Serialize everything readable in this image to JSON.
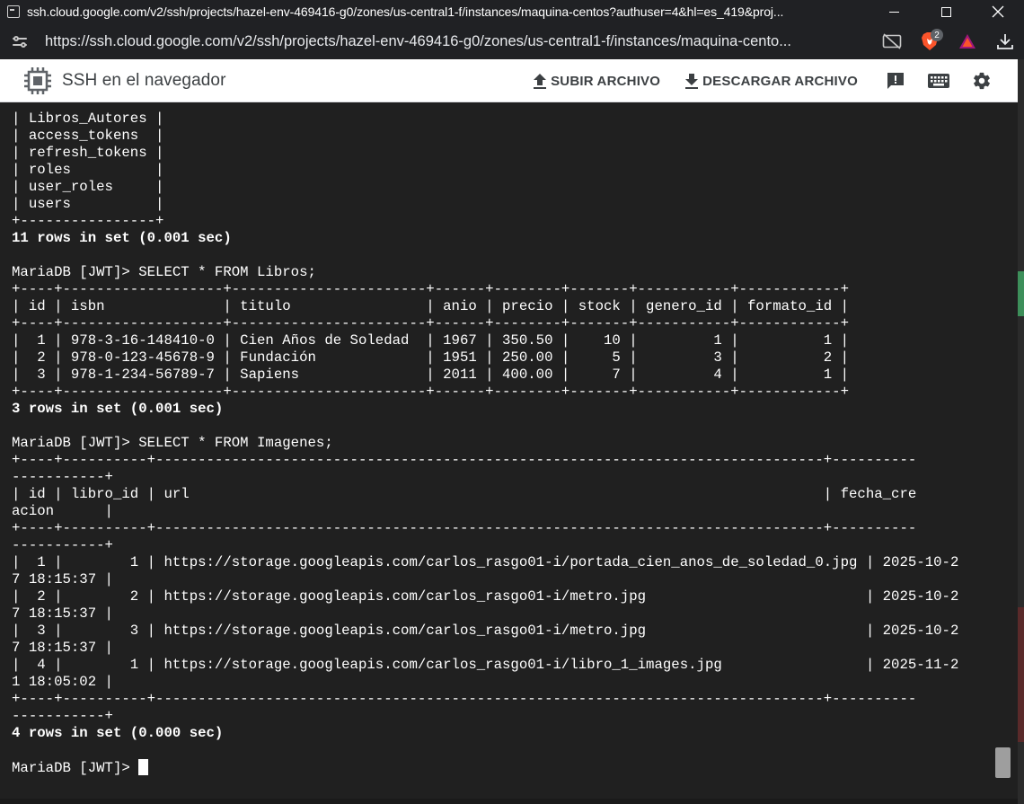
{
  "window": {
    "title": "ssh.cloud.google.com/v2/ssh/projects/hazel-env-469416-g0/zones/us-central1-f/instances/maquina-centos?authuser=4&hl=es_419&proj..."
  },
  "addressbar": {
    "url": "https://ssh.cloud.google.com/v2/ssh/projects/hazel-env-469416-g0/zones/us-central1-f/instances/maquina-cento...",
    "brave_badge_count": "2"
  },
  "app": {
    "title": "SSH en el navegador",
    "upload_label": "SUBIR ARCHIVO",
    "download_label": "DESCARGAR ARCHIVO"
  },
  "terminal": {
    "lines": [
      {
        "text": "| Libros_Autores |",
        "bold": false
      },
      {
        "text": "| access_tokens  |",
        "bold": false
      },
      {
        "text": "| refresh_tokens |",
        "bold": false
      },
      {
        "text": "| roles          |",
        "bold": false
      },
      {
        "text": "| user_roles     |",
        "bold": false
      },
      {
        "text": "| users          |",
        "bold": false
      },
      {
        "text": "+----------------+",
        "bold": false
      },
      {
        "text": "11 rows in set (0.001 sec)",
        "bold": true
      },
      {
        "text": "",
        "bold": false
      },
      {
        "text": "MariaDB [JWT]> SELECT * FROM Libros;",
        "bold": false
      },
      {
        "text": "+----+-------------------+-----------------------+------+--------+-------+-----------+------------+",
        "bold": false
      },
      {
        "text": "| id | isbn              | titulo                | anio | precio | stock | genero_id | formato_id |",
        "bold": false
      },
      {
        "text": "+----+-------------------+-----------------------+------+--------+-------+-----------+------------+",
        "bold": false
      },
      {
        "text": "|  1 | 978-3-16-148410-0 | Cien Años de Soledad  | 1967 | 350.50 |    10 |         1 |          1 |",
        "bold": false
      },
      {
        "text": "|  2 | 978-0-123-45678-9 | Fundación             | 1951 | 250.00 |     5 |         3 |          2 |",
        "bold": false
      },
      {
        "text": "|  3 | 978-1-234-56789-7 | Sapiens               | 2011 | 400.00 |     7 |         4 |          1 |",
        "bold": false
      },
      {
        "text": "+----+-------------------+-----------------------+------+--------+-------+-----------+------------+",
        "bold": false
      },
      {
        "text": "3 rows in set (0.001 sec)",
        "bold": true
      },
      {
        "text": "",
        "bold": false
      },
      {
        "text": "MariaDB [JWT]> SELECT * FROM Imagenes;",
        "bold": false
      },
      {
        "text": "+----+----------+-------------------------------------------------------------------------------+----------",
        "bold": false
      },
      {
        "text": "-----------+",
        "bold": false
      },
      {
        "text": "| id | libro_id | url                                                                           | fecha_cre",
        "bold": false
      },
      {
        "text": "acion      |",
        "bold": false
      },
      {
        "text": "+----+----------+-------------------------------------------------------------------------------+----------",
        "bold": false
      },
      {
        "text": "-----------+",
        "bold": false
      },
      {
        "text": "|  1 |        1 | https://storage.googleapis.com/carlos_rasgo01-i/portada_cien_anos_de_soledad_0.jpg | 2025-10-2",
        "bold": false
      },
      {
        "text": "7 18:15:37 |",
        "bold": false
      },
      {
        "text": "|  2 |        2 | https://storage.googleapis.com/carlos_rasgo01-i/metro.jpg                          | 2025-10-2",
        "bold": false
      },
      {
        "text": "7 18:15:37 |",
        "bold": false
      },
      {
        "text": "|  3 |        3 | https://storage.googleapis.com/carlos_rasgo01-i/metro.jpg                          | 2025-10-2",
        "bold": false
      },
      {
        "text": "7 18:15:37 |",
        "bold": false
      },
      {
        "text": "|  4 |        1 | https://storage.googleapis.com/carlos_rasgo01-i/libro_1_images.jpg                 | 2025-11-2",
        "bold": false
      },
      {
        "text": "1 18:05:02 |",
        "bold": false
      },
      {
        "text": "+----+----------+-------------------------------------------------------------------------------+----------",
        "bold": false
      },
      {
        "text": "-----------+",
        "bold": false
      },
      {
        "text": "4 rows in set (0.000 sec)",
        "bold": true
      },
      {
        "text": "",
        "bold": false
      }
    ],
    "prompt": "MariaDB [JWT]> "
  }
}
